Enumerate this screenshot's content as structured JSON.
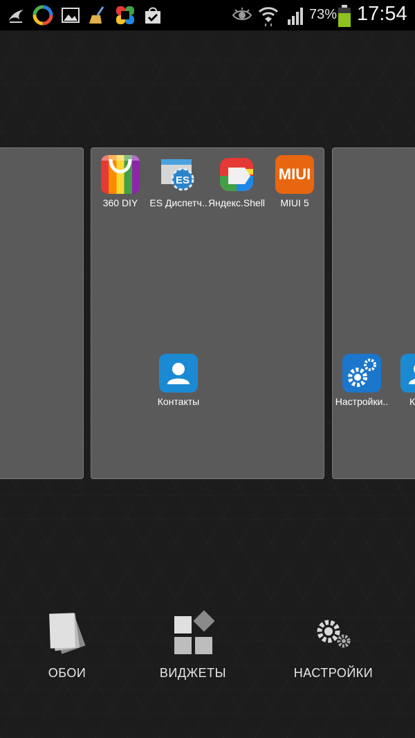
{
  "status_bar": {
    "battery_percent": "73%",
    "time": "17:54"
  },
  "home_screens": {
    "center": {
      "apps": [
        {
          "label": "360 DIY",
          "icon": "shopping-bag-icon"
        },
        {
          "label": "ES Диспетч..",
          "icon": "es-file-explorer-icon"
        },
        {
          "label": "Яндекс.Shell",
          "icon": "yandex-shell-icon"
        },
        {
          "label": "MIUI 5",
          "icon": "miui-icon"
        },
        {
          "label": "Контакты",
          "icon": "contacts-icon"
        }
      ],
      "miui_badge": "MIUI"
    },
    "right": {
      "apps": [
        {
          "label": "Настройки..",
          "icon": "settings-gears-icon"
        },
        {
          "label": "Конт",
          "icon": "contacts-icon"
        }
      ]
    }
  },
  "dock": {
    "wallpapers_label": "ОБОИ",
    "widgets_label": "ВИДЖЕТЫ",
    "settings_label": "НАСТРОЙКИ"
  },
  "colors": {
    "screen_bg": "#5a5a5a",
    "contacts_blue": "#1b8ad3",
    "miui_orange": "#e8660f",
    "battery_green": "#8dc21f"
  }
}
